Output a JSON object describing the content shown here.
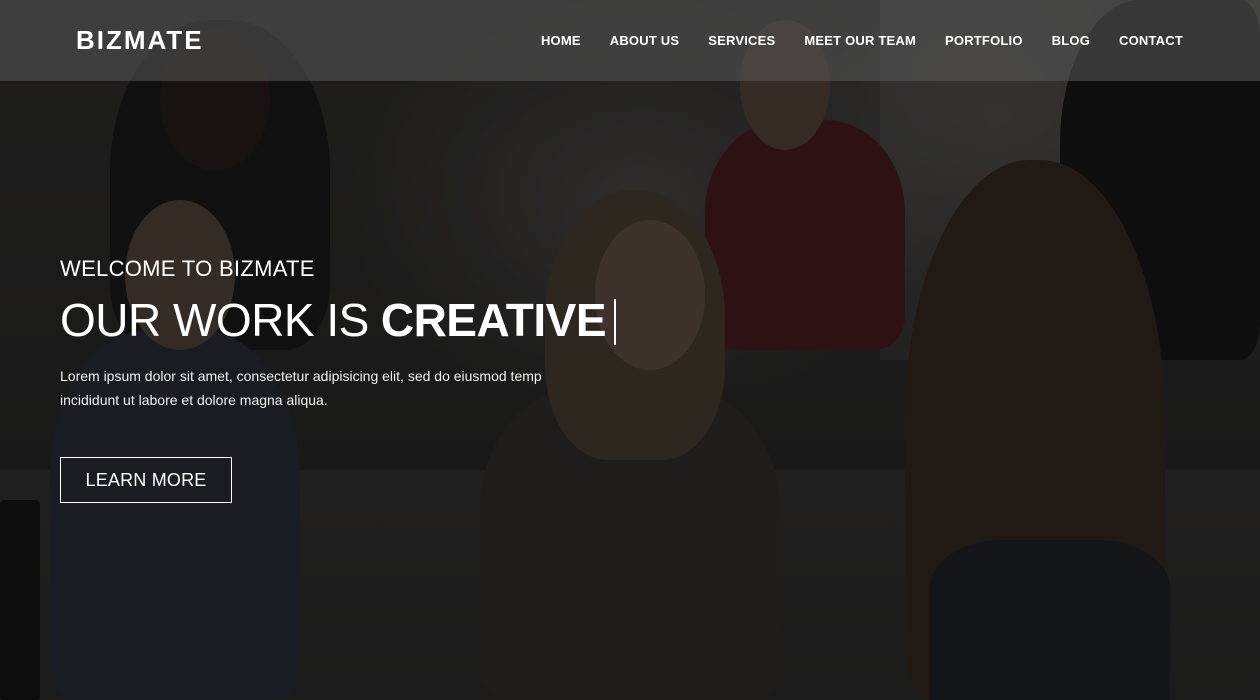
{
  "brand": {
    "name": "BIZMATE"
  },
  "nav": {
    "items": [
      {
        "label": "HOME"
      },
      {
        "label": "ABOUT US"
      },
      {
        "label": "SERVICES"
      },
      {
        "label": "MEET OUR TEAM"
      },
      {
        "label": "PORTFOLIO"
      },
      {
        "label": "BLOG"
      },
      {
        "label": "CONTACT"
      }
    ]
  },
  "hero": {
    "welcome": "WELCOME TO BIZMATE",
    "headline_prefix": "OUR WORK IS",
    "headline_highlight": "CREATIVE",
    "description": "Lorem ipsum dolor sit amet, consectetur adipisicing elit, sed do eiusmod temp incididunt ut labore et dolore magna aliqua.",
    "cta_label": "LEARN MORE"
  },
  "colors": {
    "text": "#ffffff",
    "nav_bg": "rgba(90,90,90,0.55)",
    "overlay": "rgba(10,10,10,0.55)"
  }
}
